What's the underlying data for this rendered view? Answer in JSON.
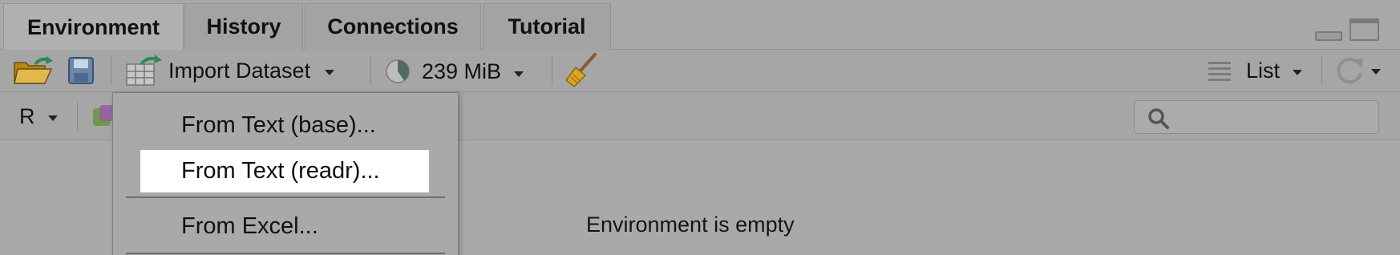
{
  "tabs": [
    {
      "label": "Environment",
      "active": true
    },
    {
      "label": "History",
      "active": false
    },
    {
      "label": "Connections",
      "active": false
    },
    {
      "label": "Tutorial",
      "active": false
    }
  ],
  "toolbar": {
    "import_dataset_label": "Import Dataset",
    "memory_label": "239 MiB",
    "view_mode_label": "List"
  },
  "toolbar2": {
    "language_label": "R"
  },
  "import_menu": {
    "items": [
      {
        "label": "From Text (base)...",
        "highlighted": false
      },
      {
        "label": "From Text (readr)...",
        "highlighted": true
      },
      {
        "label": "From Excel...",
        "highlighted": false
      }
    ]
  },
  "main": {
    "empty_message": "Environment is empty"
  },
  "icons": [
    "open-folder-icon",
    "save-icon",
    "import-dataset-icon",
    "memory-pie-icon",
    "broom-icon",
    "list-icon",
    "refresh-icon",
    "search-icon",
    "minimize-icon",
    "maximize-icon"
  ],
  "colors": {
    "background": "#a9a9a9",
    "highlight": "#ffffff",
    "accent_green": "#2e8b57"
  }
}
